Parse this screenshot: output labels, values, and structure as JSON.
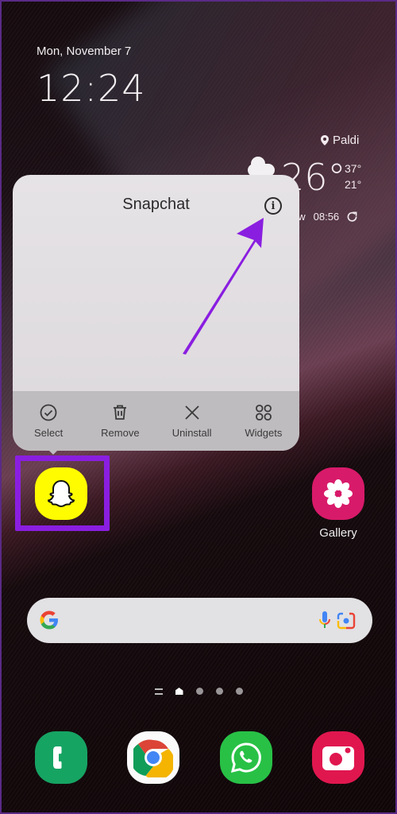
{
  "status": {
    "date": "Mon, November 7",
    "time": "12:24"
  },
  "weather": {
    "location": "Paldi",
    "temperature": "26°",
    "high": "37°",
    "low": "21°",
    "updated_label": "ow",
    "updated_time": "08:56",
    "icon": "partly-cloudy-icon"
  },
  "popup": {
    "title": "Snapchat",
    "info_icon": "info-icon",
    "actions": [
      {
        "label": "Select",
        "icon": "check-circle-icon"
      },
      {
        "label": "Remove",
        "icon": "trash-icon"
      },
      {
        "label": "Uninstall",
        "icon": "close-icon"
      },
      {
        "label": "Widgets",
        "icon": "widgets-icon"
      }
    ]
  },
  "annotation": {
    "arrow_color": "#8a1ee0",
    "highlight_color": "#8a1ee0"
  },
  "home": {
    "apps": [
      {
        "name": "Snapchat",
        "label": "",
        "color": "#fffc00"
      },
      {
        "name": "Gallery",
        "label": "Gallery",
        "color": "#d81a6a"
      }
    ]
  },
  "search_bar": {
    "logo": "google-g-icon",
    "voice": "microphone-icon",
    "lens": "google-lens-icon"
  },
  "pager": {
    "pages": 4,
    "current": "home"
  },
  "dock": [
    {
      "name": "Phone",
      "color": "#16a463"
    },
    {
      "name": "Chrome",
      "color": "#fafafa"
    },
    {
      "name": "WhatsApp",
      "color": "#28c146"
    },
    {
      "name": "Camera",
      "color": "#e0174f"
    }
  ]
}
